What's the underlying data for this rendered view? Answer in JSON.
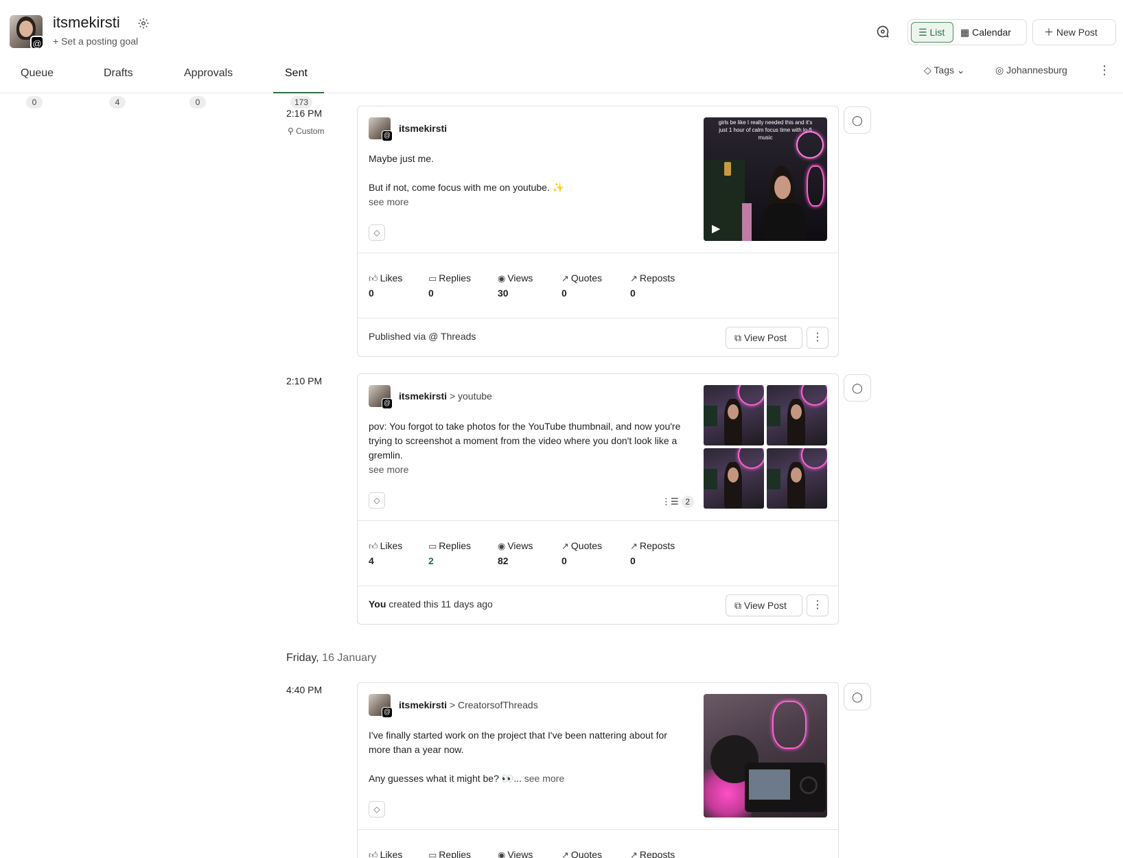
{
  "account": {
    "name": "itsmekirsti",
    "goal_link": "+ Set a posting goal"
  },
  "toolbar": {
    "list_label": "List",
    "calendar_label": "Calendar",
    "new_post_label": "New Post"
  },
  "tabs": [
    {
      "label": "Queue",
      "count": "0"
    },
    {
      "label": "Drafts",
      "count": "4"
    },
    {
      "label": "Approvals",
      "count": "0"
    },
    {
      "label": "Sent",
      "count": "173"
    }
  ],
  "filters": {
    "tags_label": "Tags",
    "timezone_label": "Johannesburg"
  },
  "stat_labels": {
    "likes": "Likes",
    "replies": "Replies",
    "views": "Views",
    "quotes": "Quotes",
    "reposts": "Reposts"
  },
  "posts": [
    {
      "time": "2:16 PM",
      "schedule_type": "Custom",
      "author": "itsmekirsti",
      "destination": "",
      "body": [
        "Maybe just me.",
        "But if not, come focus with me on youtube. ✨"
      ],
      "see_more": "see more",
      "media_caption": "girls be like I really needed this and it's just 1 hour of calm focus time with lo-fi music",
      "stats": {
        "likes": "0",
        "replies": "0",
        "views": "30",
        "quotes": "0",
        "reposts": "0"
      },
      "footer_prefix": "Published via",
      "footer_channel": "Threads",
      "view_post_label": "View Post"
    },
    {
      "time": "2:10 PM",
      "author": "itsmekirsti",
      "destination": "> youtube",
      "body": [
        "pov: You forgot to take photos for the YouTube thumbnail, and now you're trying to screenshot a moment from the video where you don't look like a gremlin."
      ],
      "see_more": "see more",
      "thread_count": "2",
      "stats": {
        "likes": "4",
        "replies": "2",
        "views": "82",
        "quotes": "0",
        "reposts": "0"
      },
      "footer_bold": "You",
      "footer_rest": "created this 11 days ago",
      "view_post_label": "View Post"
    },
    {
      "day_weekday": "Friday,",
      "day_date": "16 January",
      "time": "4:40 PM",
      "author": "itsmekirsti",
      "destination": "> CreatorsofThreads",
      "body": [
        "I've finally started work on the project that I've been nattering about for more than a year now.",
        "Any guesses what it might be? 👀..."
      ],
      "see_more": "see more"
    }
  ],
  "colors": {
    "accent": "#2d6e41",
    "accent_bg": "#ebf5ee",
    "neon": "#ff5fd3"
  },
  "icons": [
    "gear-icon",
    "chat-bubble-icon",
    "list-icon",
    "calendar-icon",
    "plus-icon",
    "tag-icon",
    "globe-icon",
    "chevron-down-icon",
    "kebab-icon",
    "thumbs-up-icon",
    "reply-icon",
    "eye-icon",
    "trending-icon",
    "external-link-icon",
    "threads-icon",
    "play-icon",
    "thread-icon"
  ]
}
